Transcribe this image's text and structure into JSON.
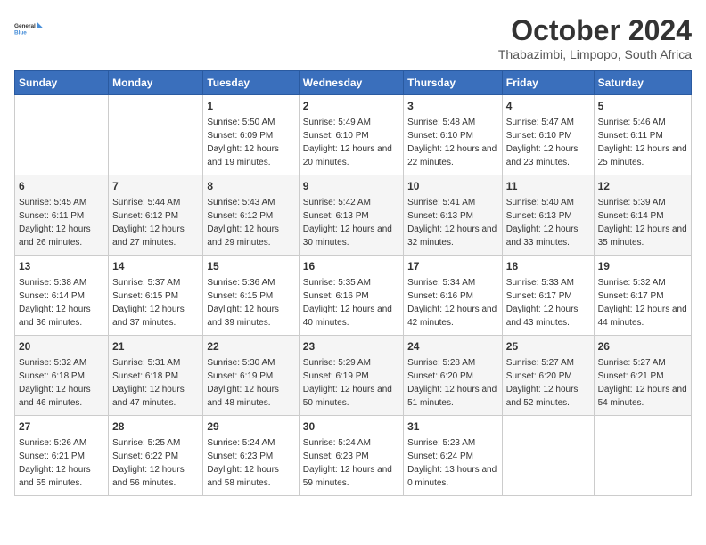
{
  "header": {
    "logo_line1": "General",
    "logo_line2": "Blue",
    "month_title": "October 2024",
    "subtitle": "Thabazimbi, Limpopo, South Africa"
  },
  "weekdays": [
    "Sunday",
    "Monday",
    "Tuesday",
    "Wednesday",
    "Thursday",
    "Friday",
    "Saturday"
  ],
  "weeks": [
    [
      {
        "day": "",
        "info": ""
      },
      {
        "day": "",
        "info": ""
      },
      {
        "day": "1",
        "info": "Sunrise: 5:50 AM\nSunset: 6:09 PM\nDaylight: 12 hours and 19 minutes."
      },
      {
        "day": "2",
        "info": "Sunrise: 5:49 AM\nSunset: 6:10 PM\nDaylight: 12 hours and 20 minutes."
      },
      {
        "day": "3",
        "info": "Sunrise: 5:48 AM\nSunset: 6:10 PM\nDaylight: 12 hours and 22 minutes."
      },
      {
        "day": "4",
        "info": "Sunrise: 5:47 AM\nSunset: 6:10 PM\nDaylight: 12 hours and 23 minutes."
      },
      {
        "day": "5",
        "info": "Sunrise: 5:46 AM\nSunset: 6:11 PM\nDaylight: 12 hours and 25 minutes."
      }
    ],
    [
      {
        "day": "6",
        "info": "Sunrise: 5:45 AM\nSunset: 6:11 PM\nDaylight: 12 hours and 26 minutes."
      },
      {
        "day": "7",
        "info": "Sunrise: 5:44 AM\nSunset: 6:12 PM\nDaylight: 12 hours and 27 minutes."
      },
      {
        "day": "8",
        "info": "Sunrise: 5:43 AM\nSunset: 6:12 PM\nDaylight: 12 hours and 29 minutes."
      },
      {
        "day": "9",
        "info": "Sunrise: 5:42 AM\nSunset: 6:13 PM\nDaylight: 12 hours and 30 minutes."
      },
      {
        "day": "10",
        "info": "Sunrise: 5:41 AM\nSunset: 6:13 PM\nDaylight: 12 hours and 32 minutes."
      },
      {
        "day": "11",
        "info": "Sunrise: 5:40 AM\nSunset: 6:13 PM\nDaylight: 12 hours and 33 minutes."
      },
      {
        "day": "12",
        "info": "Sunrise: 5:39 AM\nSunset: 6:14 PM\nDaylight: 12 hours and 35 minutes."
      }
    ],
    [
      {
        "day": "13",
        "info": "Sunrise: 5:38 AM\nSunset: 6:14 PM\nDaylight: 12 hours and 36 minutes."
      },
      {
        "day": "14",
        "info": "Sunrise: 5:37 AM\nSunset: 6:15 PM\nDaylight: 12 hours and 37 minutes."
      },
      {
        "day": "15",
        "info": "Sunrise: 5:36 AM\nSunset: 6:15 PM\nDaylight: 12 hours and 39 minutes."
      },
      {
        "day": "16",
        "info": "Sunrise: 5:35 AM\nSunset: 6:16 PM\nDaylight: 12 hours and 40 minutes."
      },
      {
        "day": "17",
        "info": "Sunrise: 5:34 AM\nSunset: 6:16 PM\nDaylight: 12 hours and 42 minutes."
      },
      {
        "day": "18",
        "info": "Sunrise: 5:33 AM\nSunset: 6:17 PM\nDaylight: 12 hours and 43 minutes."
      },
      {
        "day": "19",
        "info": "Sunrise: 5:32 AM\nSunset: 6:17 PM\nDaylight: 12 hours and 44 minutes."
      }
    ],
    [
      {
        "day": "20",
        "info": "Sunrise: 5:32 AM\nSunset: 6:18 PM\nDaylight: 12 hours and 46 minutes."
      },
      {
        "day": "21",
        "info": "Sunrise: 5:31 AM\nSunset: 6:18 PM\nDaylight: 12 hours and 47 minutes."
      },
      {
        "day": "22",
        "info": "Sunrise: 5:30 AM\nSunset: 6:19 PM\nDaylight: 12 hours and 48 minutes."
      },
      {
        "day": "23",
        "info": "Sunrise: 5:29 AM\nSunset: 6:19 PM\nDaylight: 12 hours and 50 minutes."
      },
      {
        "day": "24",
        "info": "Sunrise: 5:28 AM\nSunset: 6:20 PM\nDaylight: 12 hours and 51 minutes."
      },
      {
        "day": "25",
        "info": "Sunrise: 5:27 AM\nSunset: 6:20 PM\nDaylight: 12 hours and 52 minutes."
      },
      {
        "day": "26",
        "info": "Sunrise: 5:27 AM\nSunset: 6:21 PM\nDaylight: 12 hours and 54 minutes."
      }
    ],
    [
      {
        "day": "27",
        "info": "Sunrise: 5:26 AM\nSunset: 6:21 PM\nDaylight: 12 hours and 55 minutes."
      },
      {
        "day": "28",
        "info": "Sunrise: 5:25 AM\nSunset: 6:22 PM\nDaylight: 12 hours and 56 minutes."
      },
      {
        "day": "29",
        "info": "Sunrise: 5:24 AM\nSunset: 6:23 PM\nDaylight: 12 hours and 58 minutes."
      },
      {
        "day": "30",
        "info": "Sunrise: 5:24 AM\nSunset: 6:23 PM\nDaylight: 12 hours and 59 minutes."
      },
      {
        "day": "31",
        "info": "Sunrise: 5:23 AM\nSunset: 6:24 PM\nDaylight: 13 hours and 0 minutes."
      },
      {
        "day": "",
        "info": ""
      },
      {
        "day": "",
        "info": ""
      }
    ]
  ]
}
